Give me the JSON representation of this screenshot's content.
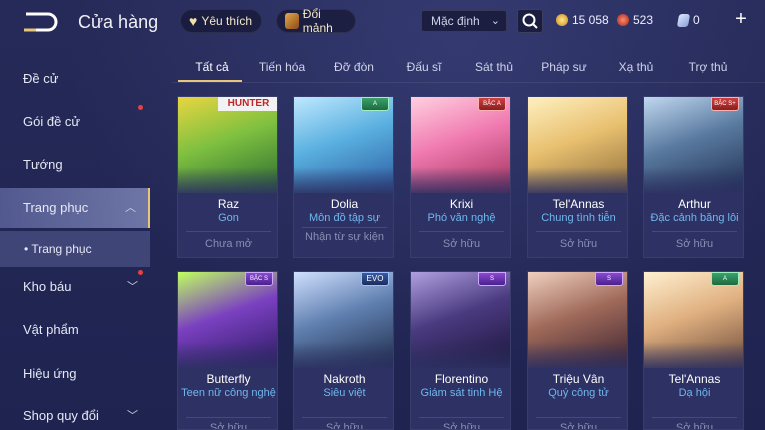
{
  "header": {
    "title": "Cửa hàng",
    "favorites_label": "Yêu thích",
    "exchange_label": "Đổi mảnh",
    "sort_value": "Mặc định",
    "currency_gold": "15 058",
    "currency_gems": "523",
    "currency_tickets": "0"
  },
  "sidebar": {
    "items": [
      {
        "label": "Đề cử"
      },
      {
        "label": "Gói đề cử"
      },
      {
        "label": "Tướng"
      },
      {
        "label": "Trang phục"
      },
      {
        "label": "• Trang phục"
      },
      {
        "label": "Kho báu"
      },
      {
        "label": "Vật phẩm"
      },
      {
        "label": "Hiệu ứng"
      },
      {
        "label": "Shop quy đổi"
      }
    ]
  },
  "tabs": [
    "Tất cả",
    "Tiến hóa",
    "Đỡ đòn",
    "Đấu sĩ",
    "Sát thủ",
    "Pháp sư",
    "Xạ thủ",
    "Trợ thủ"
  ],
  "cards": [
    {
      "hero": "Raz",
      "skin": "Gon",
      "status": "Chưa mở",
      "banner": "HUNTER",
      "badge": ""
    },
    {
      "hero": "Dolia",
      "skin": "Môn đồ tập sự",
      "status": "Nhận từ sự kiện",
      "badge": "A"
    },
    {
      "hero": "Krixi",
      "skin": "Phó văn nghệ",
      "status": "Sở hữu",
      "badge": "BẬC A"
    },
    {
      "hero": "Tel'Annas",
      "skin": "Chung tình tiễn",
      "status": "Sở hữu",
      "badge": ""
    },
    {
      "hero": "Arthur",
      "skin": "Đặc cảnh băng lôi",
      "status": "Sở hữu",
      "badge": "BẬC S+"
    },
    {
      "hero": "Butterfly",
      "skin": "Teen nữ công nghệ",
      "status": "Sở hữu",
      "badge": "BẬC S"
    },
    {
      "hero": "Nakroth",
      "skin": "Siêu việt",
      "status": "Sở hữu",
      "badge": "EVO"
    },
    {
      "hero": "Florentino",
      "skin": "Giám sát tinh Hệ",
      "status": "Sở hữu",
      "badge": "S"
    },
    {
      "hero": "Triệu Vân",
      "skin": "Quý công tử",
      "status": "Sở hữu",
      "badge": "S"
    },
    {
      "hero": "Tel'Annas",
      "skin": "Dạ hội",
      "status": "Sở hữu",
      "badge": "A"
    }
  ],
  "colors": {
    "accent_gold": "#e6c678",
    "skin_name_blue": "#6fb8f0",
    "background": "#23264f"
  }
}
